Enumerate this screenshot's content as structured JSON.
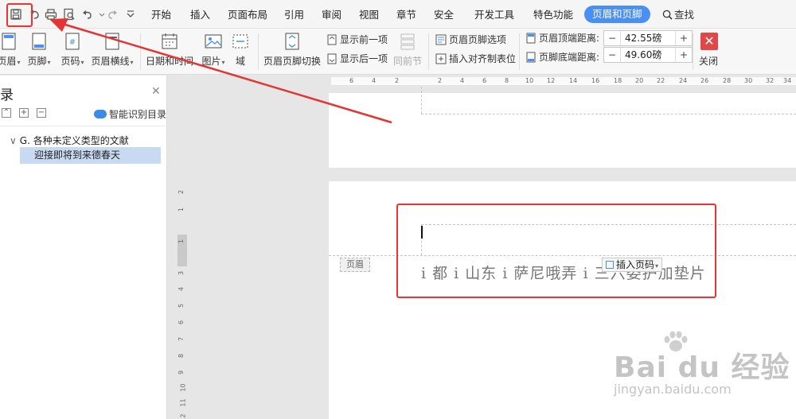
{
  "menubar": {
    "tabs": [
      "开始",
      "插入",
      "页面布局",
      "引用",
      "审阅",
      "视图",
      "章节",
      "安全",
      "开发工具",
      "特色功能"
    ],
    "active_tab": "页眉和页脚",
    "search": "查找",
    "quick_access_icons": [
      "save-icon",
      "undo-icon",
      "print-icon",
      "print-preview-icon",
      "undo-icon",
      "redo-icon",
      "more-icon"
    ]
  },
  "ribbon": {
    "header_label": "页眉",
    "footer_label": "页脚",
    "pagenum_label": "页码",
    "header_line_label": "页眉横线",
    "datetime_label": "日期和时间",
    "picture_label": "图片",
    "field_label": "域",
    "switch_label": "页眉页脚切换",
    "show_prev": "显示前一项",
    "show_next": "显示后一项",
    "same_as_prev": "同前节",
    "options_label": "页眉页脚选项",
    "insert_align_tab": "插入对齐制表位",
    "header_top_label": "页眉顶端距离:",
    "header_top_value": "42.55磅",
    "footer_bottom_label": "页脚底端距离:",
    "footer_bottom_value": "49.60磅",
    "close_label": "关闭"
  },
  "nav": {
    "title": "录",
    "smart_label": "智能识别目录",
    "items": [
      {
        "label": "G. 各种未定义类型的文献"
      },
      {
        "label": "迎接即将到来德春天"
      }
    ]
  },
  "ruler": {
    "h_ticks": [
      "6",
      "4",
      "2",
      "2",
      "4",
      "6",
      "8",
      "10",
      "12",
      "14",
      "16",
      "18",
      "20",
      "22",
      "24",
      "26",
      "28",
      "30",
      "32",
      "34"
    ],
    "v_ticks": [
      "2",
      "1",
      "1",
      "3",
      "4",
      "5",
      "6",
      "7",
      "8",
      "9",
      "10",
      "11",
      "12"
    ]
  },
  "document": {
    "header_tag": "页眉",
    "header_text": "i 都 i 山东 i 萨尼哦弄 i 三六委护加垫片",
    "insert_page_button": "插入页码"
  },
  "watermark": {
    "main": "Bai du 经验",
    "sub": "jingyan.baidu.com"
  },
  "colors": {
    "accent": "#4a8ff3",
    "annotation_red": "#e33333",
    "close_red": "#e04848"
  }
}
